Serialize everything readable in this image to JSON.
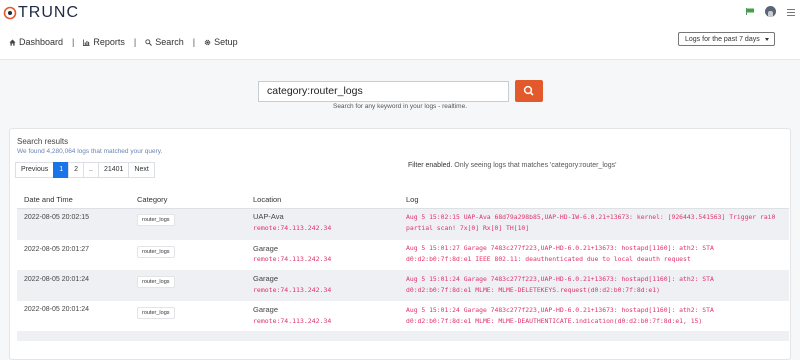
{
  "brand": {
    "name": "TRUNC"
  },
  "nav": {
    "items": [
      {
        "label": "Dashboard",
        "icon": "home-icon"
      },
      {
        "label": "Reports",
        "icon": "bar-chart-icon"
      },
      {
        "label": "Search",
        "icon": "search-icon"
      },
      {
        "label": "Setup",
        "icon": "gear-icon"
      }
    ],
    "separator": "|",
    "time_range": "Logs for the past 7 days"
  },
  "search": {
    "query": "category:router_logs",
    "help": "Search for any keyword in your logs - realtime.",
    "button_color": "#e25a2c"
  },
  "results": {
    "title": "Search results",
    "subtitle": "We found 4,280,064 logs that matched your query.",
    "filter_prefix": "Filter enabled.",
    "filter_note": " Only seeing logs that matches 'category:router_logs'",
    "pagination": {
      "previous": "Previous",
      "p1": "1",
      "p2": "2",
      "ellipsis": "..",
      "last": "21401",
      "next": "Next"
    },
    "columns": {
      "datetime": "Date and Time",
      "category": "Category",
      "location": "Location",
      "log": "Log"
    },
    "rows": [
      {
        "datetime": "2022-08-05 20:02:15",
        "category": "router_logs",
        "location": "UAP-Ava",
        "remote": "remote:74.113.242.34",
        "log": "Aug 5 15:02:15 UAP-Ava 68d79a298b85,UAP-HD-IW-6.0.21+13673: kernel: [926443.541563] Trigger rai0 partial scan! 7x[0] Rx[0] TH[10]"
      },
      {
        "datetime": "2022-08-05 20:01:27",
        "category": "router_logs",
        "location": "Garage",
        "remote": "remote:74.113.242.34",
        "log": "Aug 5 15:01:27 Garage 7483c277f223,UAP-HD-6.0.21+13673: hostapd[1160]: ath2: STA d0:d2:b0:7f:8d:e1 IEEE 802.11: deauthenticated due to local deauth request"
      },
      {
        "datetime": "2022-08-05 20:01:24",
        "category": "router_logs",
        "location": "Garage",
        "remote": "remote:74.113.242.34",
        "log": "Aug 5 15:01:24 Garage 7483c277f223,UAP-HD-6.0.21+13673: hostapd[1160]: ath2: STA d0:d2:b0:7f:8d:e1 MLME: MLME-DELETEKEYS.request(d0:d2:b0:7f:8d:e1)"
      },
      {
        "datetime": "2022-08-05 20:01:24",
        "category": "router_logs",
        "location": "Garage",
        "remote": "remote:74.113.242.34",
        "log": "Aug 5 15:01:24 Garage 7483c277f223,UAP-HD-6.0.21+13673: hostapd[1160]: ath2: STA d0:d2:b0:7f:8d:e1 MLME: MLME-DEAUTHENTICATE.indication(d0:d2:b0:7f:8d:e1, 15)"
      }
    ]
  },
  "colors": {
    "accent": "#1a73e8",
    "log_text": "#e0316b",
    "subtitle": "#6b84b3"
  }
}
